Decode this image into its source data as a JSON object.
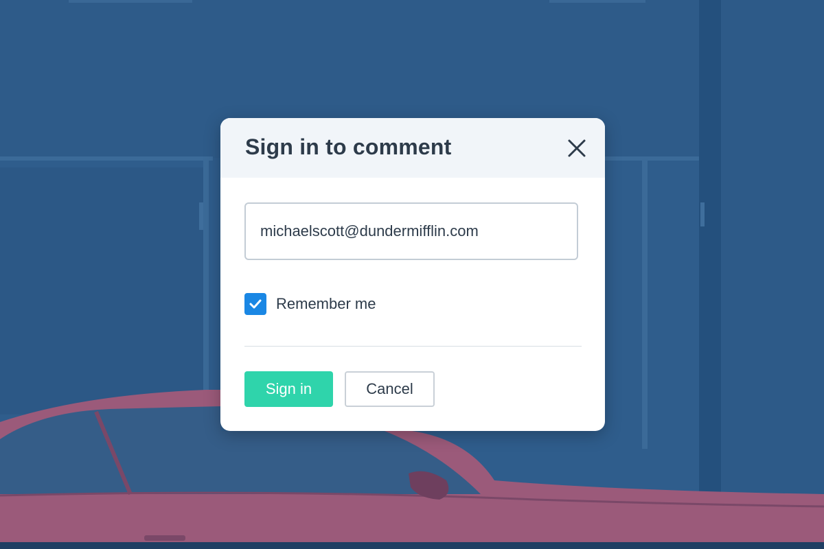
{
  "dialog": {
    "title": "Sign in to comment",
    "close_icon": "close-icon",
    "email_value": "michaelscott@dundermifflin.com",
    "remember_label": "Remember me",
    "remember_checked": true,
    "signin_label": "Sign in",
    "cancel_label": "Cancel"
  },
  "colors": {
    "overlay": "#2f5d8c",
    "checkbox": "#1a87e4",
    "primary_button": "#2fd4ab",
    "car": "#9b5a7a"
  }
}
